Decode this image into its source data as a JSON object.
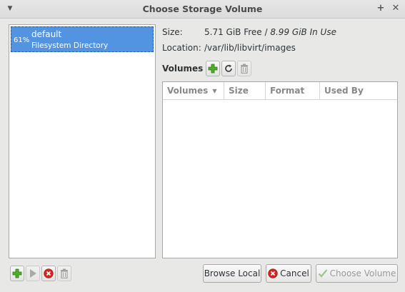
{
  "window": {
    "title": "Choose Storage Volume"
  },
  "pools": [
    {
      "percent": "61%",
      "name": "default",
      "type": "Filesystem Directory",
      "selected": true
    }
  ],
  "details": {
    "size_label": "Size:",
    "size_free": "5.71 GiB Free",
    "size_separator": " / ",
    "size_in_use": "8.99 GiB In Use",
    "location_label": "Location:",
    "location_value": "/var/lib/libvirt/images"
  },
  "volumes": {
    "label": "Volumes",
    "columns": [
      "Volumes",
      "Size",
      "Format",
      "Used By"
    ],
    "rows": []
  },
  "pool_toolbar": {
    "icons": [
      "add-pool-icon",
      "start-pool-icon",
      "stop-pool-icon",
      "delete-pool-icon"
    ]
  },
  "volume_toolbar": {
    "icons": [
      "add-volume-icon",
      "refresh-icon",
      "delete-volume-icon"
    ]
  },
  "buttons": {
    "browse_local": "Browse Local",
    "cancel": "Cancel",
    "choose_volume": "Choose Volume"
  },
  "colors": {
    "selection": "#5294e2",
    "add_green": "#4caf2a",
    "cancel_red": "#d6241f"
  }
}
